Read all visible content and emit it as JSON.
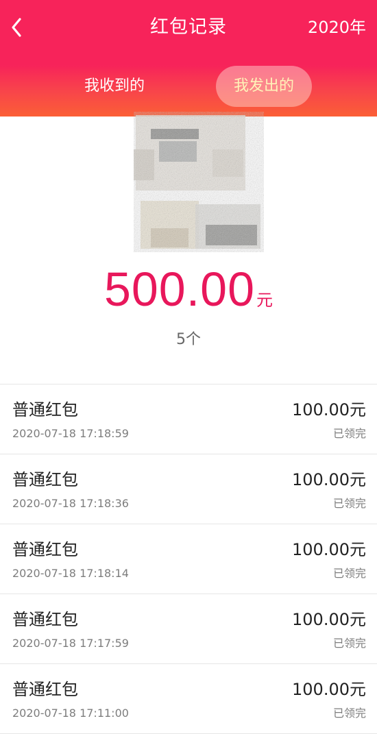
{
  "header": {
    "title": "红包记录",
    "year": "2020年",
    "back_icon": "chevron-left-icon"
  },
  "tabs": [
    {
      "label": "我收到的",
      "active": false
    },
    {
      "label": "我发出的",
      "active": true
    }
  ],
  "summary": {
    "amount": "500.00",
    "unit": "元",
    "count": "5个"
  },
  "records": [
    {
      "title": "普通红包",
      "time": "2020-07-18 17:18:59",
      "amount": "100.00元",
      "status": "已领完"
    },
    {
      "title": "普通红包",
      "time": "2020-07-18 17:18:36",
      "amount": "100.00元",
      "status": "已领完"
    },
    {
      "title": "普通红包",
      "time": "2020-07-18 17:18:14",
      "amount": "100.00元",
      "status": "已领完"
    },
    {
      "title": "普通红包",
      "time": "2020-07-18 17:17:59",
      "amount": "100.00元",
      "status": "已领完"
    },
    {
      "title": "普通红包",
      "time": "2020-07-18 17:11:00",
      "amount": "100.00元",
      "status": "已领完"
    }
  ],
  "colors": {
    "header": "#f7235a",
    "accent": "#e8175b",
    "active_tab_text": "#fff3b8"
  }
}
